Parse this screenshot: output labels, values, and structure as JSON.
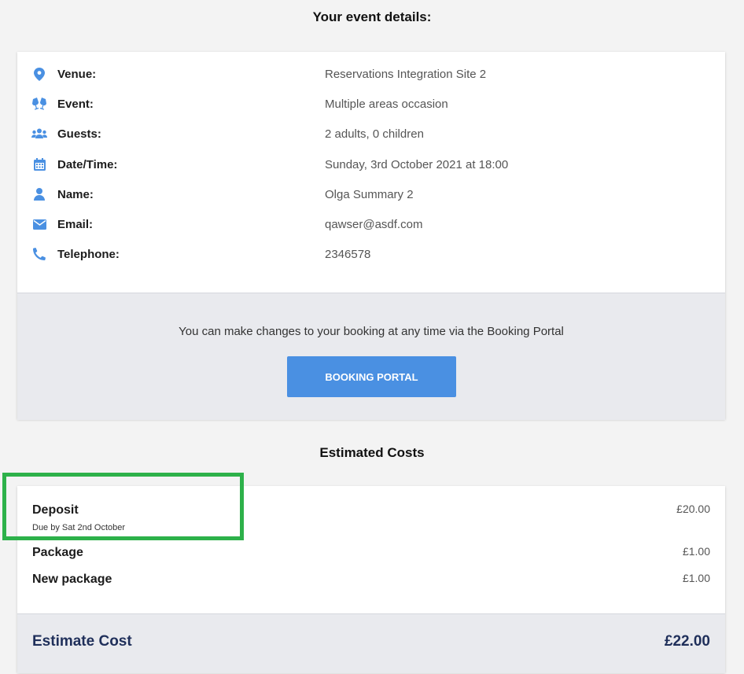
{
  "header": {
    "title": "Your event details:"
  },
  "details": [
    {
      "icon": "map-pin-icon",
      "label": "Venue:",
      "value": "Reservations Integration Site 2"
    },
    {
      "icon": "glasses-cheers-icon",
      "label": "Event:",
      "value": "Multiple areas occasion"
    },
    {
      "icon": "users-icon",
      "label": "Guests:",
      "value": "2 adults, 0 children"
    },
    {
      "icon": "calendar-icon",
      "label": "Date/Time:",
      "value": "Sunday, 3rd October 2021 at 18:00"
    },
    {
      "icon": "user-icon",
      "label": "Name:",
      "value": "Olga Summary 2"
    },
    {
      "icon": "envelope-icon",
      "label": "Email:",
      "value": "qawser@asdf.com"
    },
    {
      "icon": "phone-icon",
      "label": "Telephone:",
      "value": "2346578"
    }
  ],
  "portal": {
    "text": "You can make changes to your booking at any time via the Booking Portal",
    "button_label": "BOOKING PORTAL"
  },
  "costs": {
    "title": "Estimated Costs",
    "items": [
      {
        "label": "Deposit",
        "sublabel": "Due by Sat 2nd October",
        "amount": "£20.00"
      },
      {
        "label": "Package",
        "amount": "£1.00"
      },
      {
        "label": "New package",
        "amount": "£1.00"
      }
    ],
    "total_label": "Estimate Cost",
    "total_amount": "£22.00"
  },
  "colors": {
    "accent": "#4a90e2",
    "highlight": "#2db14a",
    "total_text": "#1f2f5a"
  }
}
